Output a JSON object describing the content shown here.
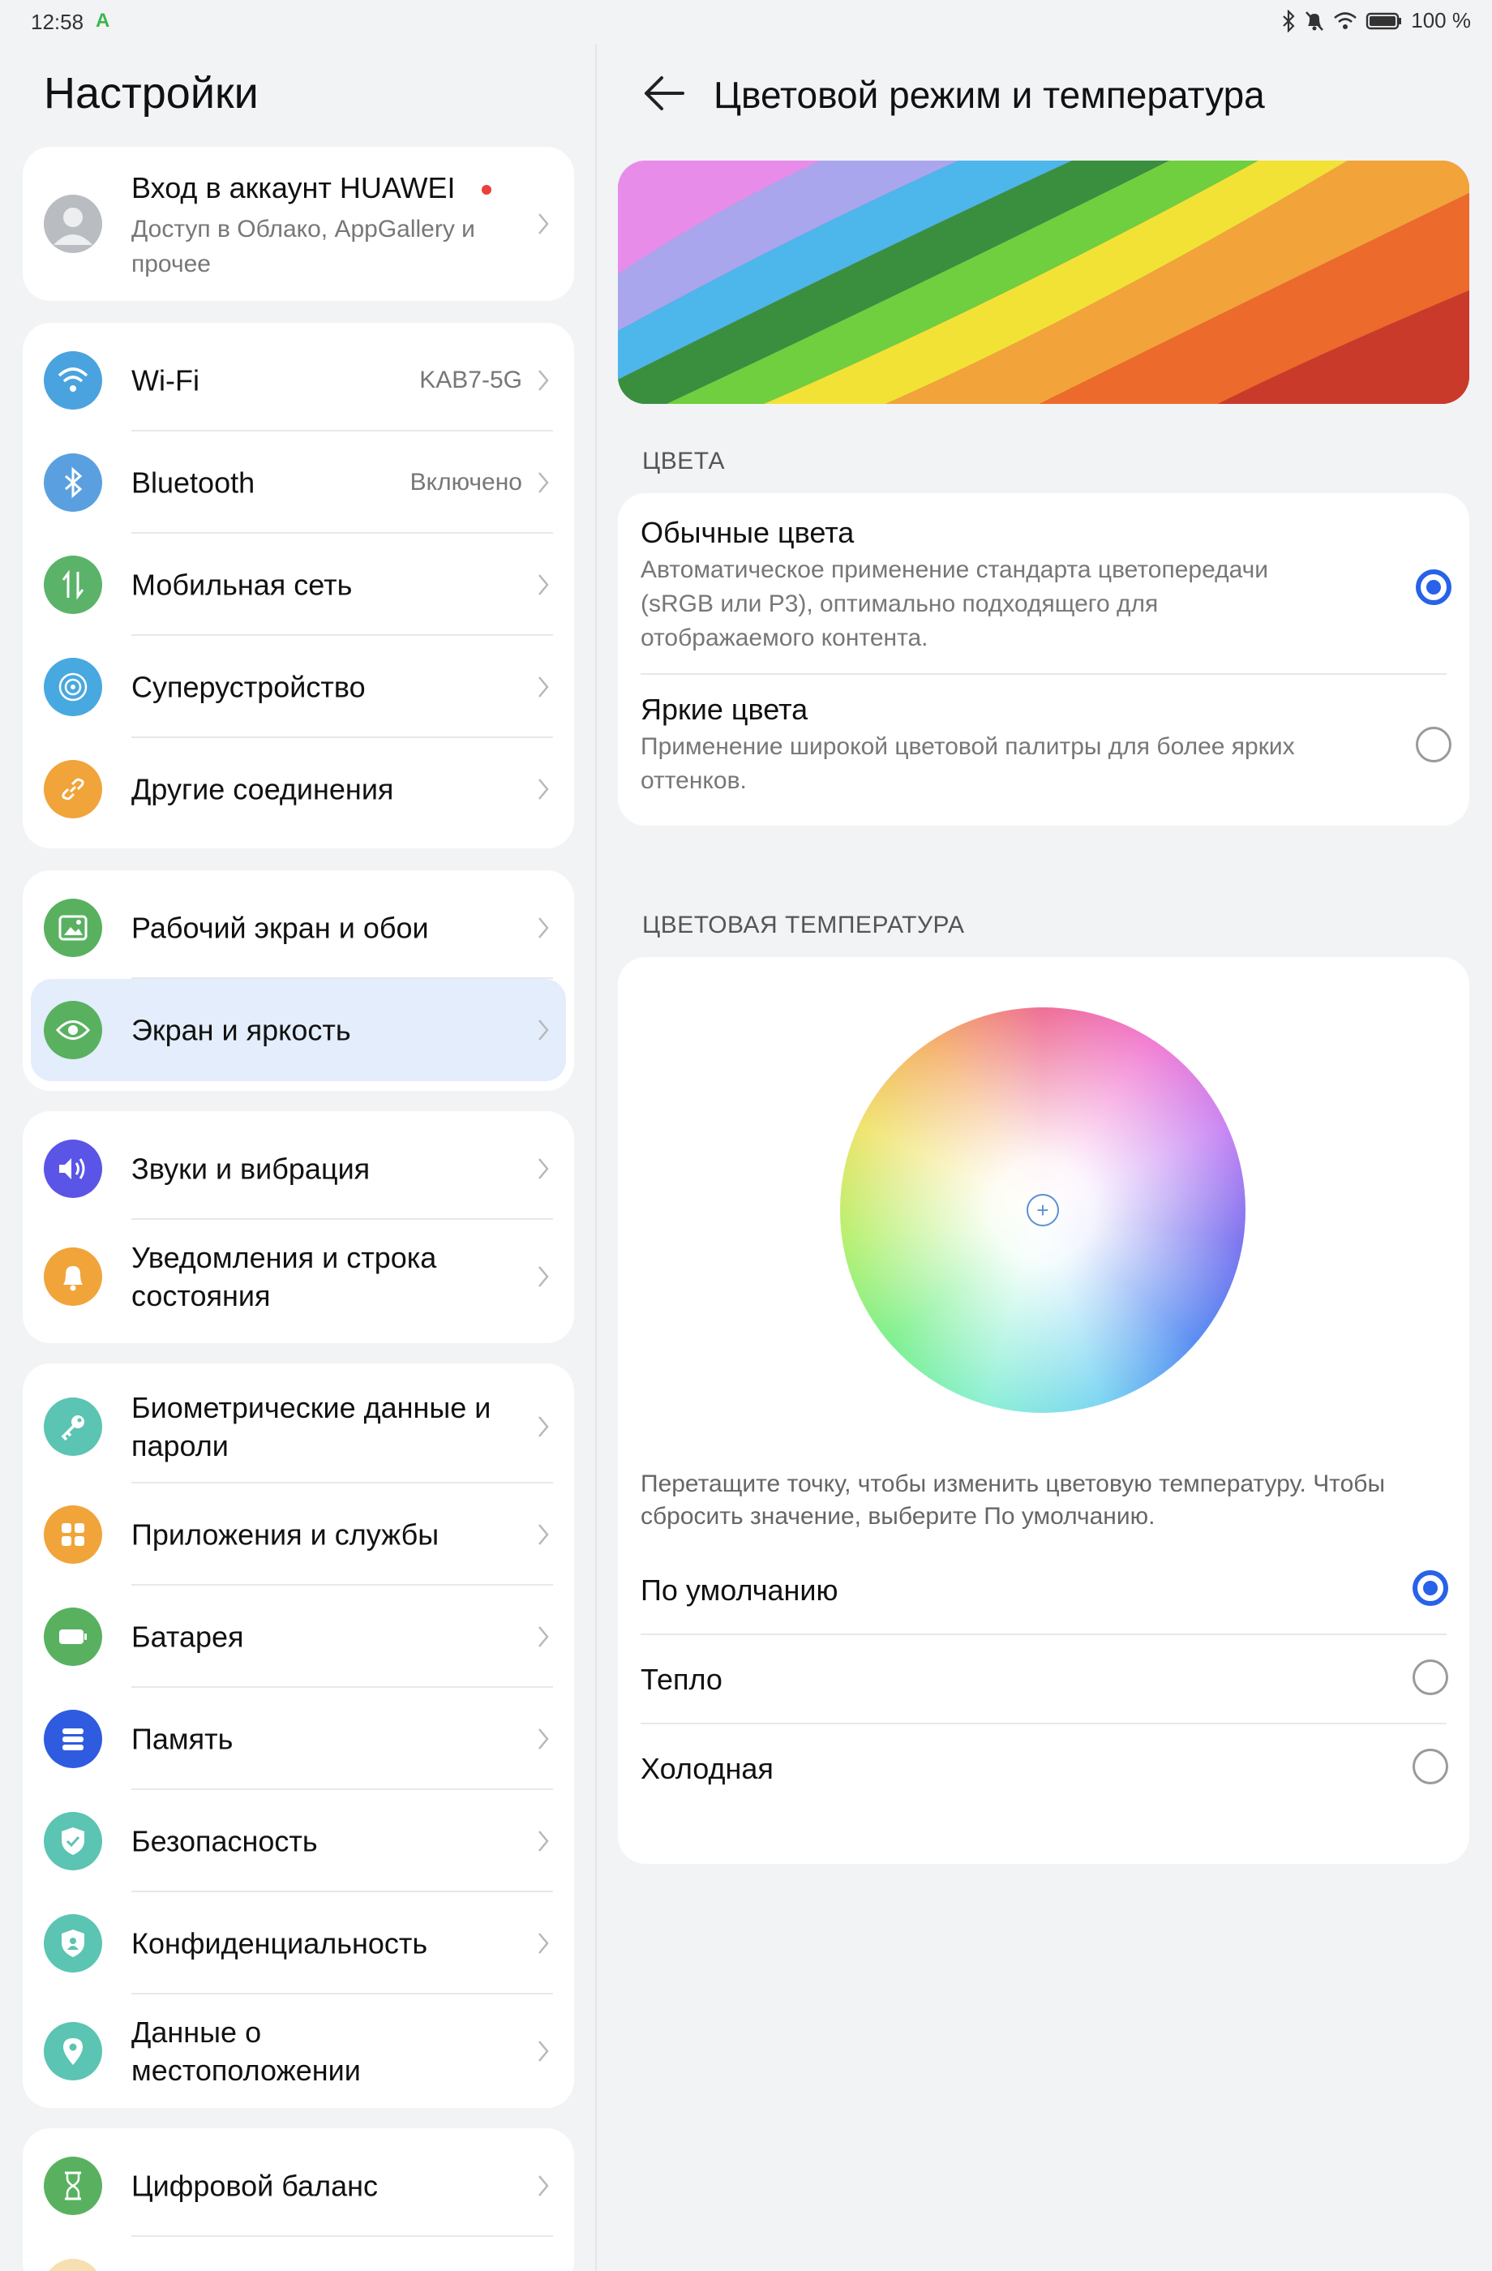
{
  "status": {
    "time": "12:58",
    "battery": "100 %"
  },
  "left": {
    "title": "Настройки",
    "account": {
      "title": "Вход в аккаунт HUAWEI",
      "subtitle": "Доступ в Облако, AppGallery и прочее"
    },
    "connections": [
      {
        "label": "Wi-Fi",
        "value": "KAB7-5G",
        "icon": "wifi-icon",
        "color": "#4aa3df"
      },
      {
        "label": "Bluetooth",
        "value": "Включено",
        "icon": "bluetooth-icon",
        "color": "#5aa0e0"
      },
      {
        "label": "Мобильная сеть",
        "value": "",
        "icon": "mobile-data-icon",
        "color": "#5bb36a"
      },
      {
        "label": "Суперустройство",
        "value": "",
        "icon": "superdevice-icon",
        "color": "#48a8e0"
      },
      {
        "label": "Другие соединения",
        "value": "",
        "icon": "link-icon",
        "color": "#f0a43a"
      }
    ],
    "display": [
      {
        "label": "Рабочий экран и обои",
        "icon": "wallpaper-icon",
        "color": "#59b160"
      },
      {
        "label": "Экран и яркость",
        "icon": "eye-icon",
        "color": "#59b160",
        "selected": true
      }
    ],
    "sound": [
      {
        "label": "Звуки и вибрация",
        "icon": "volume-icon",
        "color": "#5a55e6"
      },
      {
        "label": "Уведомления и строка состояния",
        "icon": "bell-icon",
        "color": "#f0a43a"
      }
    ],
    "security": [
      {
        "label": "Биометрические данные и пароли",
        "icon": "key-icon",
        "color": "#5bc4b3"
      },
      {
        "label": "Приложения и службы",
        "icon": "apps-icon",
        "color": "#f0a43a"
      },
      {
        "label": "Батарея",
        "icon": "battery-icon",
        "color": "#59b160"
      },
      {
        "label": "Память",
        "icon": "storage-icon",
        "color": "#2f5be0"
      },
      {
        "label": "Безопасность",
        "icon": "shield-check-icon",
        "color": "#5bc4b3"
      },
      {
        "label": "Конфиденциальность",
        "icon": "privacy-icon",
        "color": "#5bc4b3"
      },
      {
        "label": "Данные о местоположении",
        "icon": "location-icon",
        "color": "#5bc4b3"
      }
    ],
    "wellbeing": [
      {
        "label": "Цифровой баланс",
        "icon": "hourglass-icon",
        "color": "#59b160"
      }
    ]
  },
  "right": {
    "title": "Цветовой режим и температура",
    "colors_header": "ЦВЕТА",
    "normal": {
      "title": "Обычные цвета",
      "desc": "Автоматическое применение стандарта цветопередачи (sRGB или P3), оптимально подходящего для отображаемого контента.",
      "selected": true
    },
    "vivid": {
      "title": "Яркие цвета",
      "desc": "Применение широкой цветовой палитры для более ярких оттенков.",
      "selected": false
    },
    "temp_header": "ЦВЕТОВАЯ ТЕМПЕРАТУРА",
    "hint": "Перетащите точку, чтобы изменить цветовую температуру. Чтобы сбросить значение, выберите По умолчанию.",
    "temps": [
      {
        "label": "По умолчанию",
        "selected": true
      },
      {
        "label": "Тепло",
        "selected": false
      },
      {
        "label": "Холодная",
        "selected": false
      }
    ],
    "accent": "#2762e8"
  }
}
